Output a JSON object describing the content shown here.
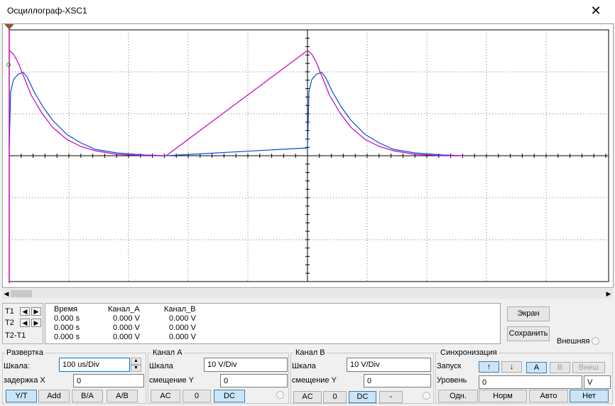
{
  "window": {
    "title": "Осциллограф-XSC1",
    "close_glyph": "✕"
  },
  "cursors": {
    "t1": "T1",
    "t2": "T2",
    "t2t1": "T2-T1"
  },
  "readout": {
    "headers": [
      "Время",
      "Канал_A",
      "Канал_B"
    ],
    "rows": [
      [
        "0.000 s",
        "0.000 V",
        "0.000 V"
      ],
      [
        "0.000 s",
        "0.000 V",
        "0.000 V"
      ],
      [
        "0.000 s",
        "0.000 V",
        "0.000 V"
      ]
    ]
  },
  "side": {
    "screen_btn": "Экран",
    "save_btn": "Сохранить",
    "external": "Внешняя"
  },
  "timebase": {
    "title": "Развертка",
    "scale_label": "Шкала:",
    "scale_value": "100 us/Div",
    "delay_label": "задержка X",
    "delay_value": "0",
    "buttons": [
      "Y/T",
      "Add",
      "B/A",
      "A/B"
    ]
  },
  "channel_a": {
    "title": "Канал A",
    "scale_label": "Шкала",
    "scale_value": "10  V/Div",
    "offset_label": "смещение Y",
    "offset_value": "0",
    "buttons": [
      "AC",
      "0",
      "DC"
    ]
  },
  "channel_b": {
    "title": "Канал B",
    "scale_label": "Шкала",
    "scale_value": "10  V/Div",
    "offset_label": "смещение Y",
    "offset_value": "0",
    "buttons": [
      "AC",
      "0",
      "DC",
      "-"
    ]
  },
  "trigger": {
    "title": "Синхронизация",
    "edge_label": "Запуск",
    "level_label": "Уровень",
    "level_value": "0",
    "level_unit": "V",
    "edge_buttons": [
      "↑",
      "↓"
    ],
    "source_buttons": [
      "A",
      "B",
      "Внеш"
    ],
    "mode_buttons": [
      "Одн.",
      "Норм",
      "Авто",
      "Нет"
    ]
  },
  "colors": {
    "channel_a": "#c000c0",
    "channel_b": "#0050d0",
    "grid": "#000000"
  }
}
